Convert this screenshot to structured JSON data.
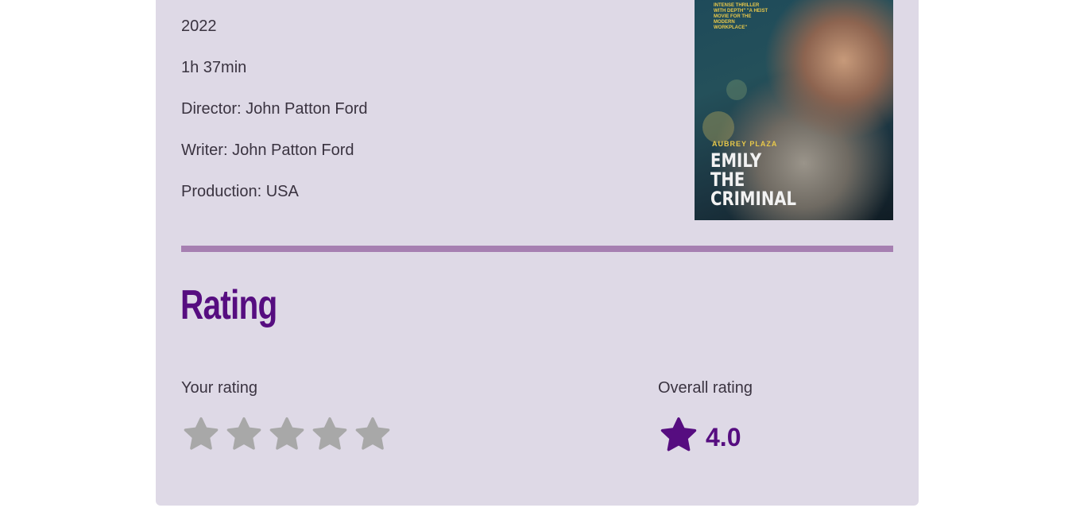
{
  "film": {
    "year": "2022",
    "duration": "1h 37min",
    "director": "Director: John Patton Ford",
    "writer": "Writer: John Patton Ford",
    "production": "Production: USA"
  },
  "poster": {
    "tagline": "INTENSE THRILLER WITH DEPTH\" \"A HEIST MOVIE FOR THE MODERN WORKPLACE\"",
    "actor": "AUBREY PLAZA",
    "title_line1": "EMILY",
    "title_line2": "THE",
    "title_line3": "CRIMINAL"
  },
  "rating": {
    "heading": "Rating",
    "your_rating_label": "Your rating",
    "your_rating_value": 0,
    "max_stars": 5,
    "overall_label": "Overall rating",
    "overall_value": "4.0"
  },
  "colors": {
    "card_bg": "#ded9e6",
    "accent": "#560d80",
    "divider": "#a67fb1",
    "star_empty": "#a8a8a8"
  },
  "icons": {
    "star": "star-icon"
  }
}
